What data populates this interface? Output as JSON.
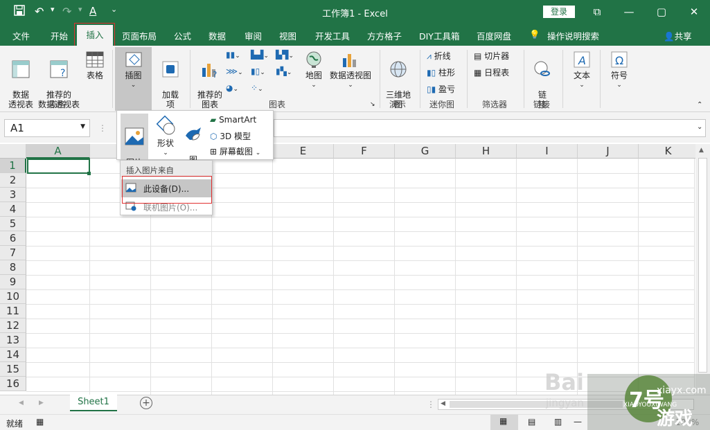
{
  "titlebar": {
    "title": "工作簿1  -  Excel",
    "login": "登录",
    "minimize": "—",
    "restore": "▢",
    "close": "✕",
    "ribbon_display": "⧉"
  },
  "tabs": [
    "文件",
    "开始",
    "插入",
    "页面布局",
    "公式",
    "数据",
    "审阅",
    "视图",
    "开发工具",
    "方方格子",
    "DIY工具箱",
    "百度网盘",
    "操作说明搜索",
    "共享"
  ],
  "ribbon": {
    "pivot": "数据\n透视表",
    "recommended_pivot": "推荐的\n数据透视表",
    "table": "表格",
    "illustrations": "插图",
    "addins": "加载\n项",
    "recommended_charts": "推荐的\n图表",
    "maps": "地图",
    "pivot_chart": "数据透视图",
    "3d_map": "三维地\n图",
    "sparkline_line": "折线",
    "sparkline_column": "柱形",
    "sparkline_winloss": "盈亏",
    "slicer": "切片器",
    "timeline": "日程表",
    "link": "链\n接",
    "text": "文本",
    "symbol": "符号",
    "groups": {
      "tables": "表格",
      "charts": "图表",
      "tours": "演示",
      "sparklines": "迷你图",
      "filters": "筛选器",
      "links": "链接"
    }
  },
  "name_box": "A1",
  "pictures_dropdown": {
    "pictures": "图片",
    "shapes": "形状",
    "icons": "图\n标",
    "smartart": "SmartArt",
    "models": "3D 模型",
    "screenshot": "屏幕截图"
  },
  "insert_from": {
    "header": "插入图片来自",
    "this_device": "此设备(D)...",
    "online": "联机图片(O)..."
  },
  "columns": [
    "A",
    "B",
    "C",
    "D",
    "E",
    "F",
    "G",
    "H",
    "I",
    "J",
    "K"
  ],
  "rows": [
    "1",
    "2",
    "3",
    "4",
    "5",
    "6",
    "7",
    "8",
    "9",
    "10",
    "11",
    "12",
    "13",
    "14",
    "15",
    "16"
  ],
  "sheet_tab": "Sheet1",
  "add_sheet": "+",
  "status": {
    "ready": "就绪",
    "zoom": "100%"
  },
  "watermark": {
    "baidu": "Bai",
    "jingyan": "jingyan",
    "site": "xiayx.com",
    "pinyin": "XIAOYOUXIWANG",
    "game": "游戏"
  },
  "colors": {
    "brand": "#217346",
    "highlight": "#e03030"
  }
}
